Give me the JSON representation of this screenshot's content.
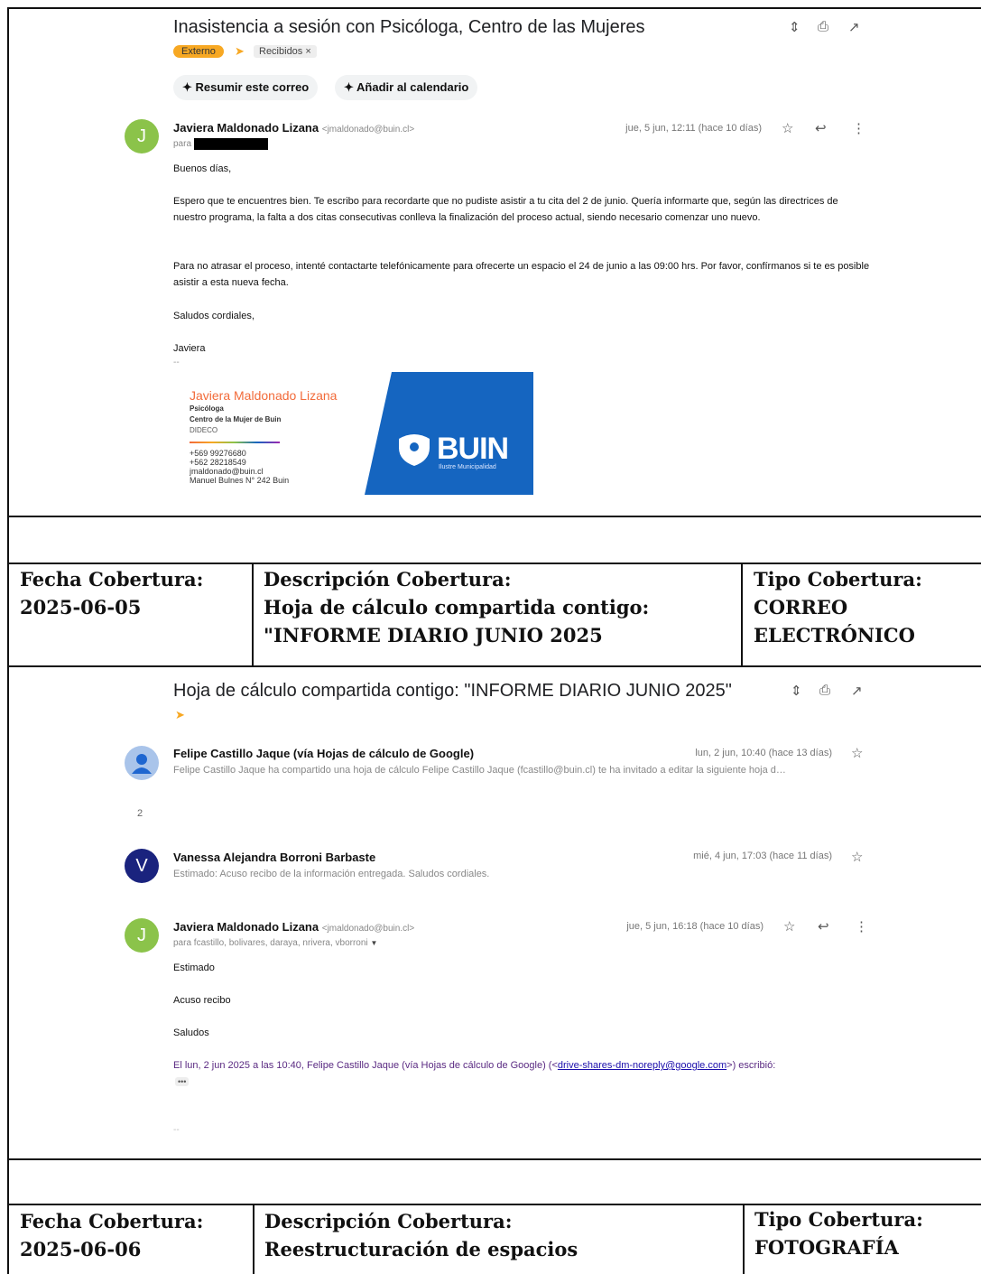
{
  "email1": {
    "subject": "Inasistencia a sesión con Psicóloga, Centro de las Mujeres",
    "label_external": "Externo",
    "label_inbox": "Recibidos ×",
    "chip_summarize": "Resumir este correo",
    "chip_calendar": "Añadir al calendario",
    "sender_name": "Javiera Maldonado Lizana",
    "sender_email": "<jmaldonado@buin.cl>",
    "to_prefix": "para",
    "date": "jue, 5 jun, 12:11 (hace 10 días)",
    "avatar_letter": "J",
    "greeting": "Buenos días,",
    "paragraph1": "Espero que te encuentres bien. Te escribo para recordarte que no pudiste asistir a tu cita del 2 de junio. Quería informarte que, según las directrices de nuestro programa, la falta a dos citas consecutivas conlleva la finalización del proceso actual, siendo necesario comenzar uno nuevo.",
    "paragraph2": "Para no atrasar el proceso, intenté contactarte telefónicamente para ofrecerte un espacio el 24 de junio a las 09:00 hrs. Por favor, confírmanos si te es posible asistir a esta nueva fecha.",
    "closing": "Saludos cordiales,",
    "signoff": "Javiera",
    "sig_name": "Javiera Maldonado Lizana",
    "sig_role": "Psicóloga",
    "sig_org": "Centro de la Mujer de Buin",
    "sig_dept": "DIDECO",
    "sig_phone1": "+569 99276680",
    "sig_phone2": "+562 28218549",
    "sig_email": "jmaldonado@buin.cl",
    "sig_address": "Manuel Bulnes N° 242 Buin",
    "logo_text": "BUIN",
    "logo_sub": "Ilustre Municipalidad"
  },
  "row1": {
    "fecha_label": "Fecha Cobertura:",
    "fecha_value": "2025-06-05",
    "desc_label": "Descripción Cobertura:",
    "desc_value": "Hoja de cálculo compartida contigo: \"INFORME DIARIO JUNIO 2025",
    "tipo_label": "Tipo Cobertura:",
    "tipo_value": "CORREO ELECTRÓNICO"
  },
  "email2": {
    "subject": "Hoja de cálculo compartida contigo: \"INFORME DIARIO JUNIO 2025\"",
    "msg1_sender": "Felipe Castillo Jaque (vía Hojas de cálculo de Google)",
    "msg1_date": "lun, 2 jun, 10:40 (hace 13 días)",
    "msg1_snippet": "Felipe Castillo Jaque ha compartido una hoja de cálculo Felipe Castillo Jaque (fcastillo@buin.cl) te ha invitado a editar la siguiente hoja d…",
    "collapsed_count": "2",
    "msg2_avatar": "V",
    "msg2_sender": "Vanessa Alejandra Borroni Barbaste",
    "msg2_date": "mié, 4 jun, 17:03 (hace 11 días)",
    "msg2_snippet": "Estimado: Acuso recibo de la información entregada. Saludos cordiales.",
    "msg3_avatar": "J",
    "msg3_sender": "Javiera Maldonado Lizana",
    "msg3_email": "<jmaldonado@buin.cl>",
    "msg3_date": "jue, 5 jun, 16:18 (hace 10 días)",
    "msg3_to": "para fcastillo, bolivares, daraya, nrivera, vborroni",
    "msg3_line1": "Estimado",
    "msg3_line2": "Acuso recibo",
    "msg3_line3": "Saludos",
    "quote_prefix": "El lun, 2 jun 2025 a las 10:40, Felipe Castillo Jaque (vía Hojas de cálculo de Google) (<",
    "quote_link": "drive-shares-dm-noreply@google.com",
    "quote_suffix": ">) escribió:",
    "ellipsis": "•••"
  },
  "row2": {
    "fecha_label": "Fecha Cobertura:",
    "fecha_value": "2025-06-06",
    "desc_label": "Descripción Cobertura:",
    "desc_value": "Reestructuración de espacios",
    "tipo_label": "Tipo Cobertura:",
    "tipo_value": "FOTOGRAFÍA"
  },
  "colors": {
    "avatar_green": "#8bc34a",
    "avatar_blue": "#1a237e",
    "logo_blue": "#1565c0",
    "sig_orange": "#f26b3a",
    "tag_orange": "#f7a823",
    "link_blue": "#1a0dab"
  }
}
